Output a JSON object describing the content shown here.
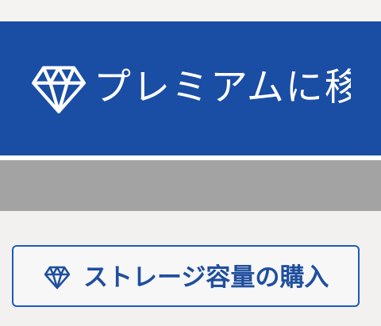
{
  "premium_banner": {
    "icon": "diamond-icon",
    "label": "プレミアムに移",
    "background_color": "#1a4da4"
  },
  "storage_button": {
    "icon": "diamond-icon",
    "label": "ストレージ容量の購入",
    "border_color": "#1f5bb6"
  }
}
